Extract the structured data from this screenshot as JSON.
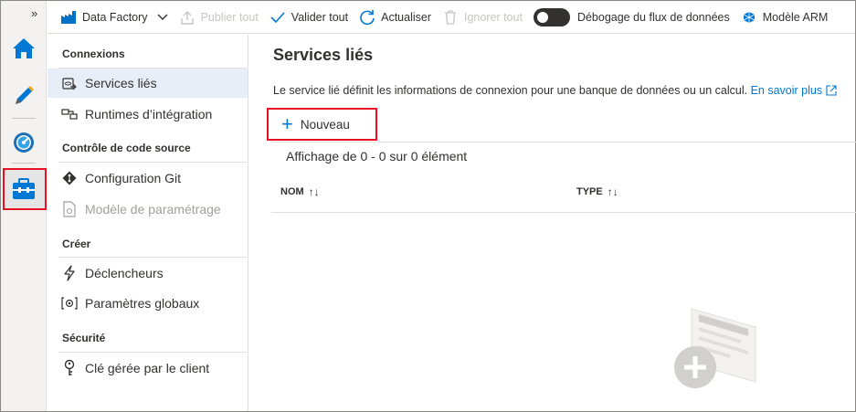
{
  "toolbar": {
    "factory_label": "Data Factory",
    "publish_label": "Publier tout",
    "validate_label": "Valider tout",
    "refresh_label": "Actualiser",
    "discard_label": "Ignorer tout",
    "debug_label": "Débogage du flux de données",
    "arm_label": "Modèle ARM"
  },
  "rail": {
    "expand_glyph": "»",
    "items": [
      "home-icon",
      "pencil-icon",
      "monitor-icon",
      "manage-toolbox-icon"
    ]
  },
  "sidenav": {
    "sections": [
      {
        "title": "Connexions",
        "items": [
          {
            "label": "Services liés",
            "icon": "linked-services-icon"
          },
          {
            "label": "Runtimes d’intégration",
            "icon": "integration-runtime-icon"
          }
        ]
      },
      {
        "title": "Contrôle de code source",
        "items": [
          {
            "label": "Configuration Git",
            "icon": "git-icon"
          },
          {
            "label": "Modèle de paramétrage",
            "icon": "parameter-template-icon"
          }
        ]
      },
      {
        "title": "Créer",
        "items": [
          {
            "label": "Déclencheurs",
            "icon": "trigger-icon"
          },
          {
            "label": "Paramètres globaux",
            "icon": "global-params-icon"
          }
        ]
      },
      {
        "title": "Sécurité",
        "items": [
          {
            "label": "Clé gérée par le client",
            "icon": "key-icon"
          }
        ]
      }
    ]
  },
  "main": {
    "title": "Services liés",
    "description": "Le service lié définit les informations de connexion pour une banque de données ou un calcul. ",
    "learn_more": "En savoir plus",
    "new_button": "Nouveau",
    "showing": "Affichage de 0 - 0 sur 0 élément",
    "columns": [
      "NOM",
      "TYPE"
    ],
    "sort_glyph": "↑↓"
  },
  "colors": {
    "accent": "#0078d4",
    "highlight": "#e81123",
    "active_nav": "#e7eef7"
  }
}
